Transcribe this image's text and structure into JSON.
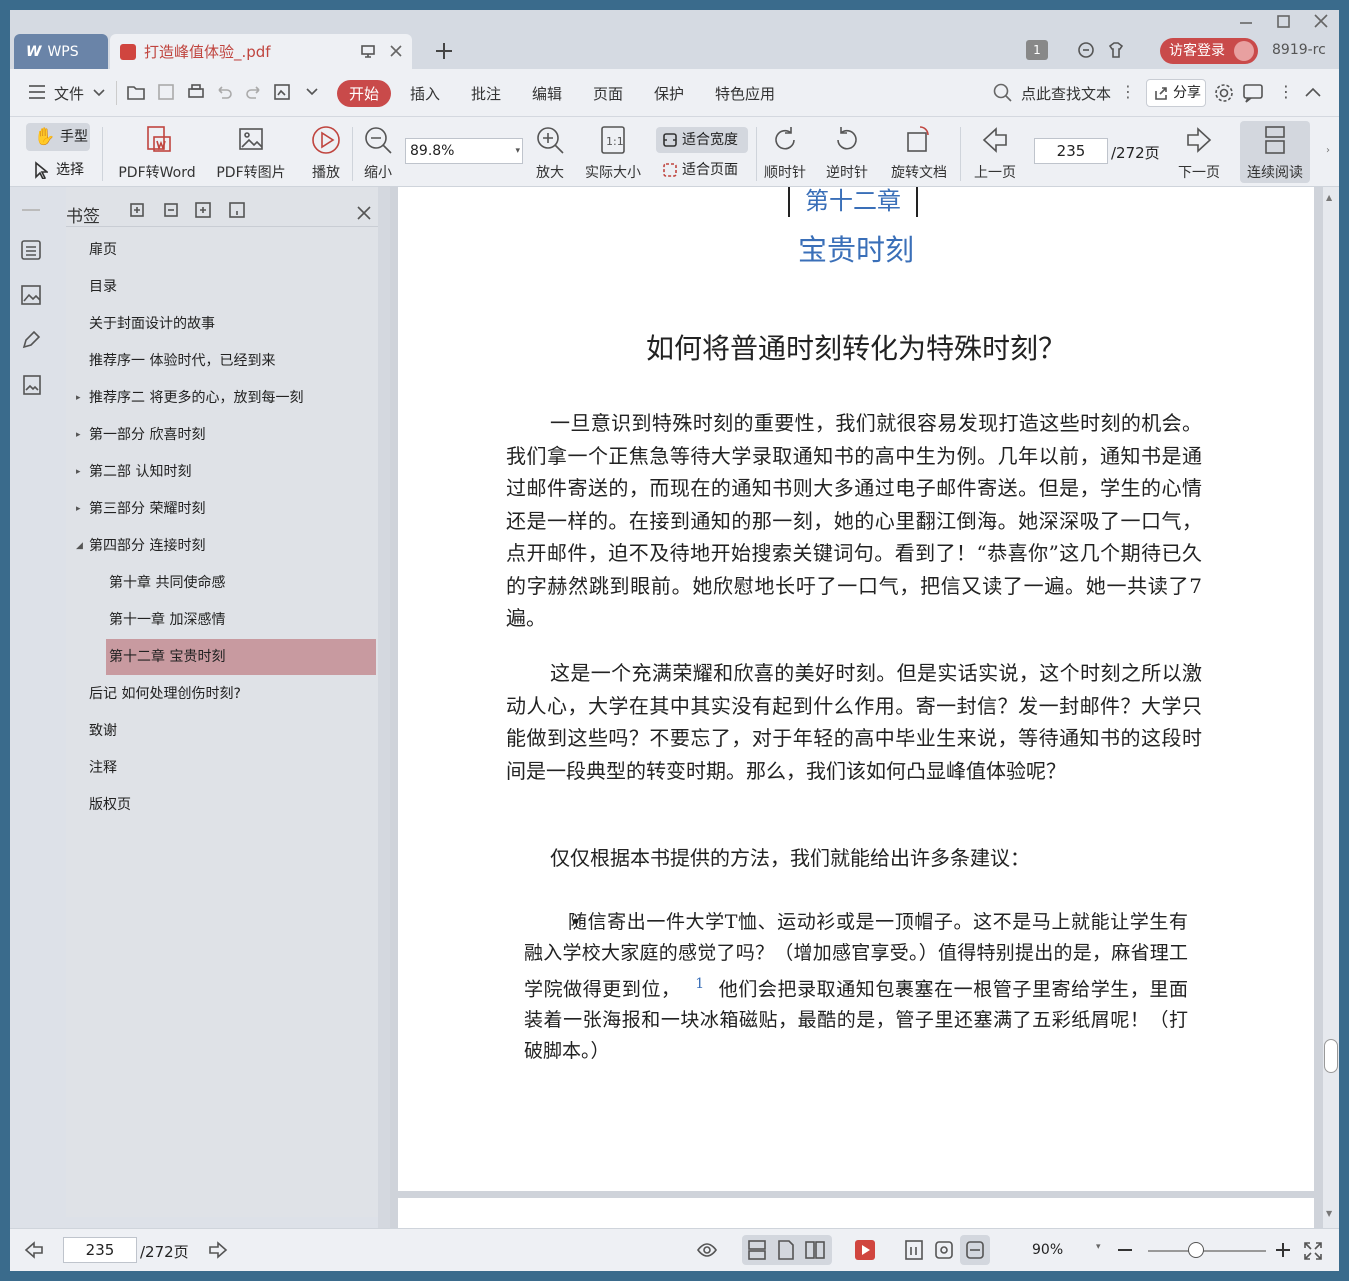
{
  "titlebar": {
    "app_tab": "WPS",
    "doc_tab": "打造峰值体验_.pdf",
    "visitor_login": "访客登录",
    "user_id": "8919-rc",
    "badge_num": "1"
  },
  "menubar": {
    "file": "文件",
    "items": [
      "开始",
      "插入",
      "批注",
      "编辑",
      "页面",
      "保护",
      "特色应用"
    ],
    "search": "点此查找文本",
    "share": "分享"
  },
  "toolbar": {
    "hand": "手型",
    "select": "选择",
    "pdf_word": "PDF转Word",
    "pdf_img": "PDF转图片",
    "play": "播放",
    "zoom_out": "缩小",
    "zoom_value": "89.8%",
    "zoom_in": "放大",
    "actual_size": "实际大小",
    "fit_width": "适合宽度",
    "fit_page": "适合页面",
    "cw": "顺时针",
    "ccw": "逆时针",
    "rotate": "旋转文档",
    "prev": "上一页",
    "page_input": "235",
    "page_total": "/272页",
    "next": "下一页",
    "continuous": "连续阅读"
  },
  "bookmarks": {
    "title": "书签",
    "items": [
      {
        "label": "扉页",
        "level": 0,
        "caret": ""
      },
      {
        "label": "目录",
        "level": 0,
        "caret": ""
      },
      {
        "label": "关于封面设计的故事",
        "level": 0,
        "caret": ""
      },
      {
        "label": "推荐序一 体验时代，已经到来",
        "level": 0,
        "caret": ""
      },
      {
        "label": "推荐序二 将更多的心，放到每一刻",
        "level": 0,
        "caret": "▸"
      },
      {
        "label": "第一部分 欣喜时刻",
        "level": 0,
        "caret": "▸"
      },
      {
        "label": "第二部 认知时刻",
        "level": 0,
        "caret": "▸"
      },
      {
        "label": "第三部分 荣耀时刻",
        "level": 0,
        "caret": "▸"
      },
      {
        "label": "第四部分 连接时刻",
        "level": 0,
        "caret": "◢"
      },
      {
        "label": "第十章 共同使命感",
        "level": 1,
        "caret": ""
      },
      {
        "label": "第十一章 加深感情",
        "level": 1,
        "caret": ""
      },
      {
        "label": "第十二章 宝贵时刻",
        "level": 1,
        "caret": "",
        "selected": true
      },
      {
        "label": "后记 如何处理创伤时刻?",
        "level": 0,
        "caret": ""
      },
      {
        "label": "致谢",
        "level": 0,
        "caret": ""
      },
      {
        "label": "注释",
        "level": 0,
        "caret": ""
      },
      {
        "label": "版权页",
        "level": 0,
        "caret": ""
      }
    ]
  },
  "document": {
    "chapter": "第十二章",
    "chapter_title": "宝贵时刻",
    "heading": "如何将普通时刻转化为特殊时刻？",
    "para1": "一旦意识到特殊时刻的重要性，我们就很容易发现打造这些时刻的机会。我们拿一个正焦急等待大学录取通知书的高中生为例。几年以前，通知书是通过邮件寄送的，而现在的通知书则大多通过电子邮件寄送。但是，学生的心情还是一样的。在接到通知的那一刻，她的心里翻江倒海。她深深吸了一口气，点开邮件，迫不及待地开始搜索关键词句。看到了！“恭喜你”这几个期待已久的字赫然跳到眼前。她欣慰地长吁了一口气，把信又读了一遍。她一共读了7遍。",
    "para2": "这是一个充满荣耀和欣喜的美好时刻。但是实话实说，这个时刻之所以激动人心，大学在其中其实没有起到什么作用。寄一封信？发一封邮件？大学只能做到这些吗？不要忘了，对于年轻的高中毕业生来说，等待通知书的这段时间是一段典型的转变时期。那么，我们该如何凸显峰值体验呢？",
    "para3": "仅仅根据本书提供的方法，我们就能给出许多条建议：",
    "bullet_a": "随信寄出一件大学T恤、运动衫或是一顶帽子。这不是马上就能让学生有融入学校大家庭的感觉了吗？（增加感官享受。）值得特别提出的是，麻省理工学院做得更到位，",
    "footnote": "1",
    "bullet_b": "他们会把录取通知包裹塞在一根管子里寄给学生，里面装着一张海报和一块冰箱磁贴，最酷的是，管子里还塞满了五彩纸屑呢！（打破脚本。）"
  },
  "status": {
    "page_input": "235",
    "page_total": "/272页",
    "zoom": "90%"
  }
}
